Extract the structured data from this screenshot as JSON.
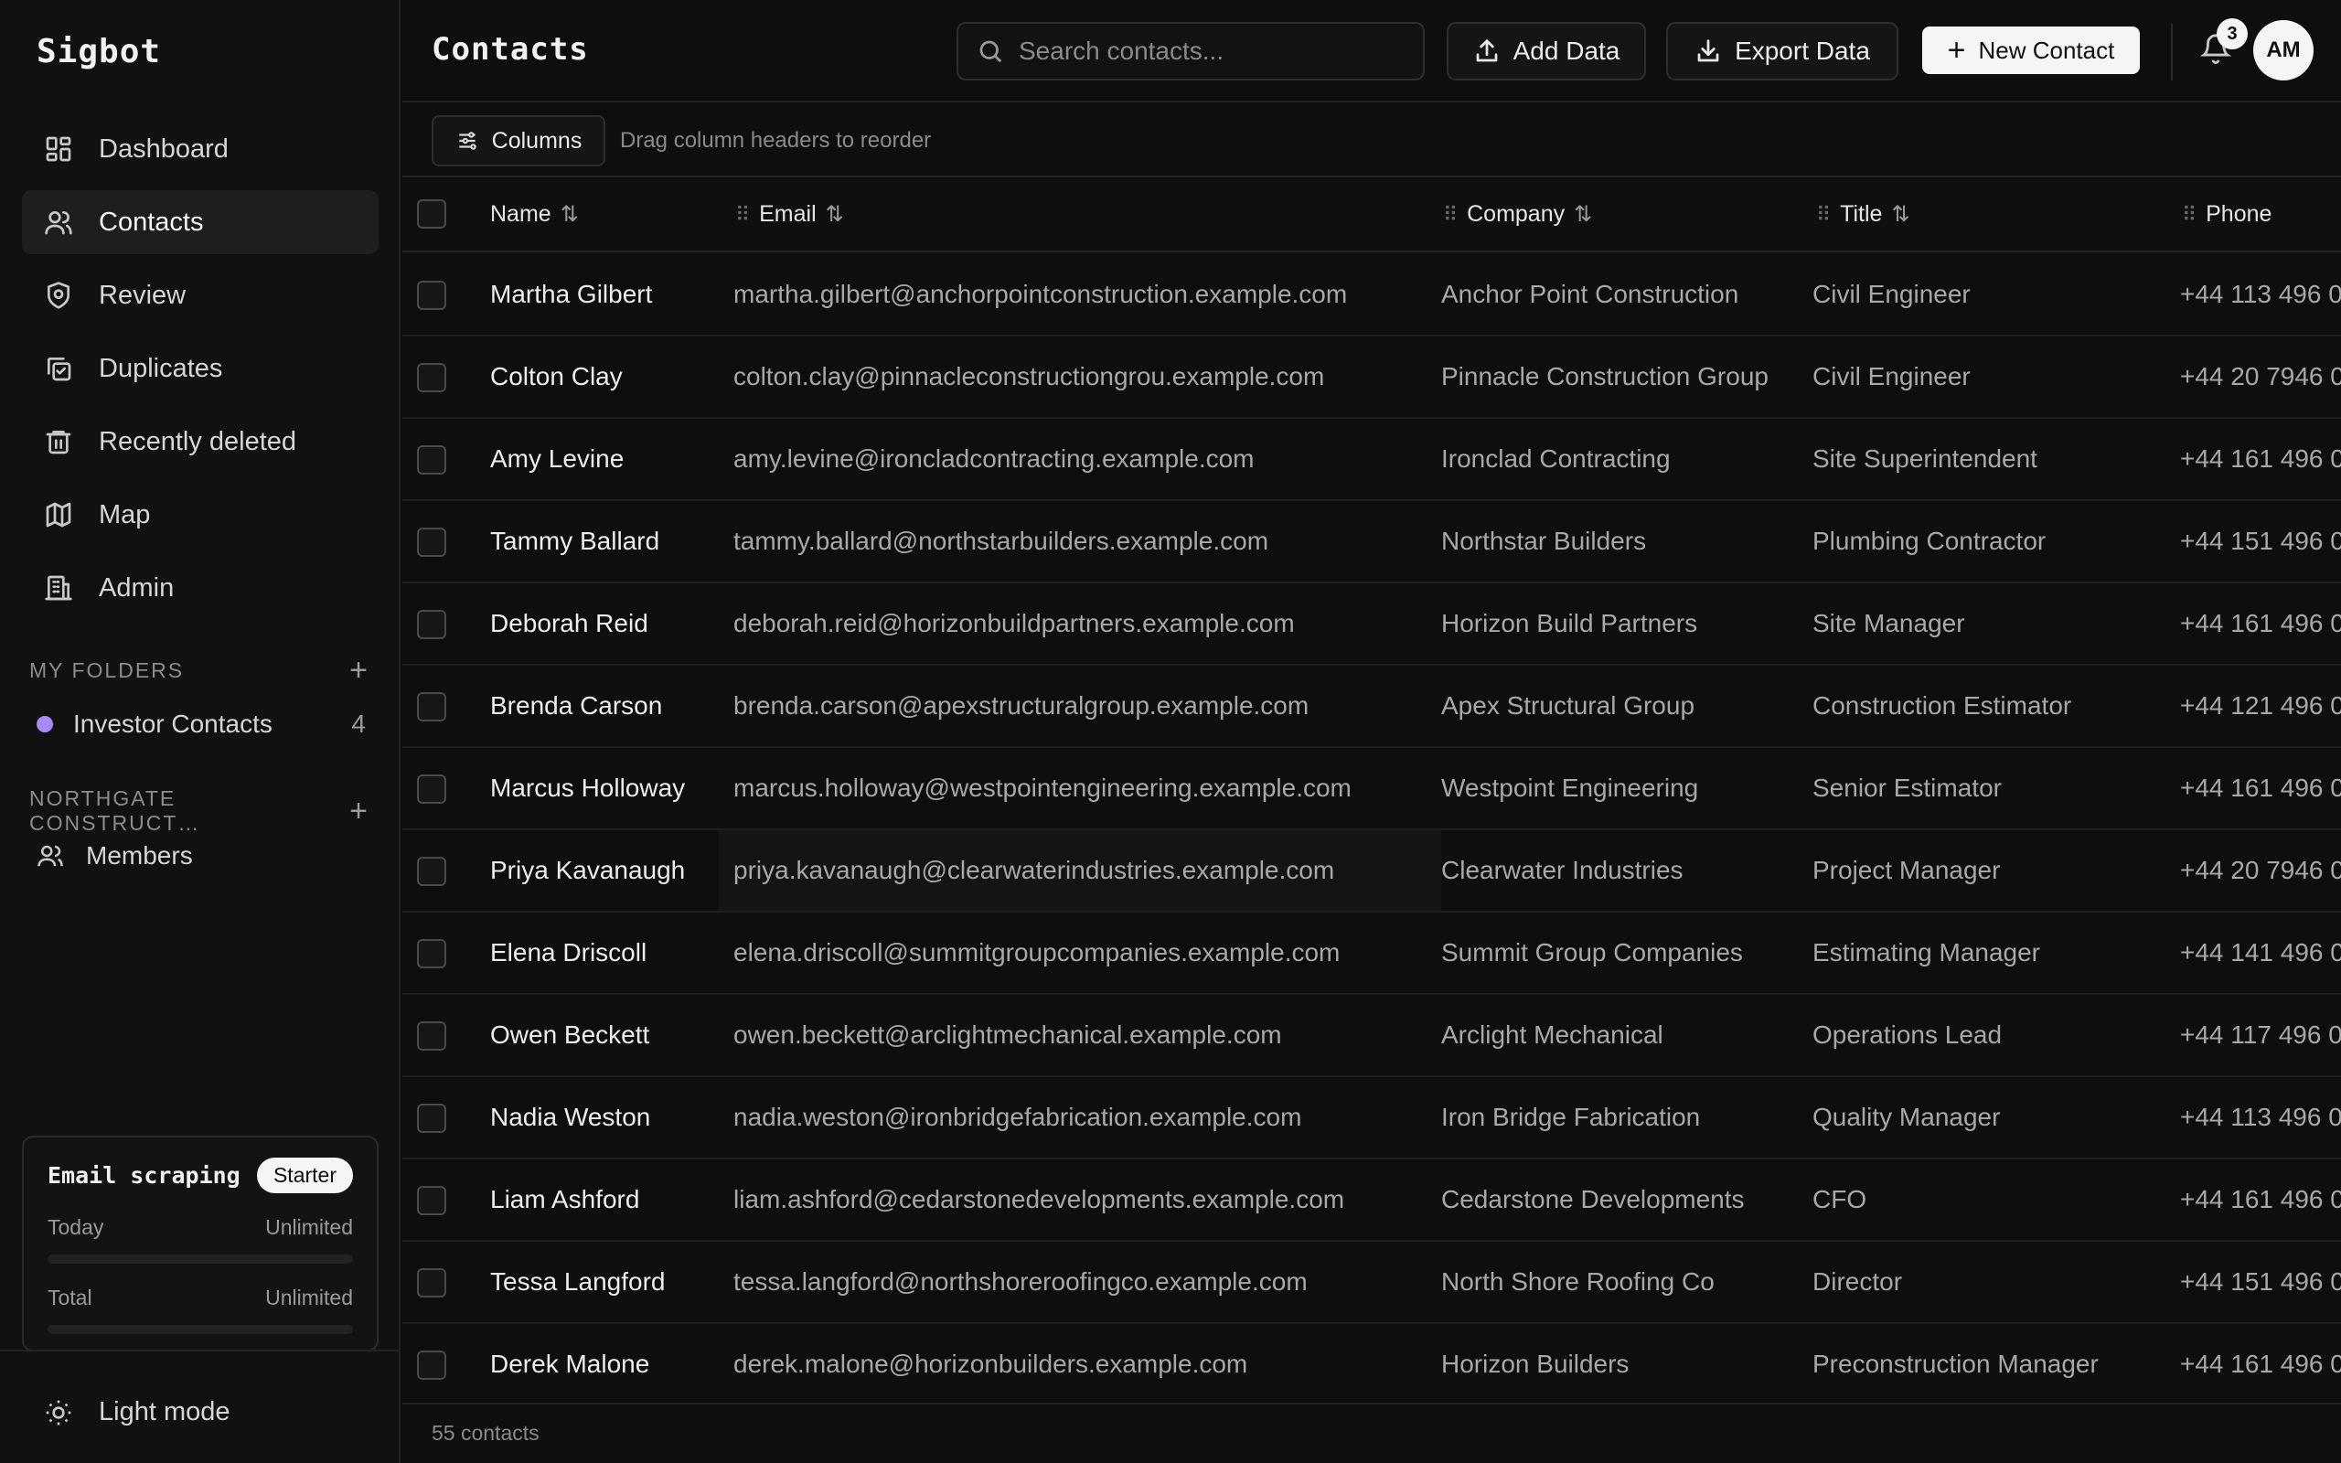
{
  "app": {
    "name": "Sigbot"
  },
  "sidebar": {
    "nav": [
      {
        "label": "Dashboard",
        "icon": "dashboard-icon"
      },
      {
        "label": "Contacts",
        "icon": "users-icon",
        "active": true
      },
      {
        "label": "Review",
        "icon": "shield-icon"
      },
      {
        "label": "Duplicates",
        "icon": "duplicate-icon"
      },
      {
        "label": "Recently deleted",
        "icon": "trash-icon"
      },
      {
        "label": "Map",
        "icon": "map-icon"
      },
      {
        "label": "Admin",
        "icon": "building-icon"
      }
    ],
    "folders_heading": "MY FOLDERS",
    "folders": [
      {
        "label": "Investor Contacts",
        "count": "4",
        "color": "#a78bfa"
      }
    ],
    "org_heading": "NORTHGATE CONSTRUCT…",
    "org_items": [
      {
        "label": "Members",
        "icon": "users-icon"
      }
    ],
    "usage": {
      "title": "Email scraping",
      "plan": "Starter",
      "today_label": "Today",
      "today_value": "Unlimited",
      "total_label": "Total",
      "total_value": "Unlimited"
    },
    "theme_toggle": "Light mode"
  },
  "header": {
    "title": "Contacts",
    "search_placeholder": "Search contacts...",
    "add_data": "Add Data",
    "export_data": "Export Data",
    "new_contact": "New Contact",
    "notification_count": "3",
    "avatar_initials": "AM"
  },
  "toolbar": {
    "columns_label": "Columns",
    "hint": "Drag column headers to reorder"
  },
  "table": {
    "columns": [
      "Name",
      "Email",
      "Company",
      "Title",
      "Phone"
    ],
    "rows": [
      {
        "name": "Martha Gilbert",
        "email": "martha.gilbert@anchorpointconstruction.example.com",
        "company": "Anchor Point Construction",
        "title": "Civil Engineer",
        "phone": "+44 113 496 0"
      },
      {
        "name": "Colton Clay",
        "email": "colton.clay@pinnacleconstructiongrou.example.com",
        "company": "Pinnacle Construction Group",
        "title": "Civil Engineer",
        "phone": "+44 20 7946 0"
      },
      {
        "name": "Amy Levine",
        "email": "amy.levine@ironcladcontracting.example.com",
        "company": "Ironclad Contracting",
        "title": "Site Superintendent",
        "phone": "+44 161 496 0"
      },
      {
        "name": "Tammy Ballard",
        "email": "tammy.ballard@northstarbuilders.example.com",
        "company": "Northstar Builders",
        "title": "Plumbing Contractor",
        "phone": "+44 151 496 0"
      },
      {
        "name": "Deborah Reid",
        "email": "deborah.reid@horizonbuildpartners.example.com",
        "company": "Horizon Build Partners",
        "title": "Site Manager",
        "phone": "+44 161 496 0"
      },
      {
        "name": "Brenda Carson",
        "email": "brenda.carson@apexstructuralgroup.example.com",
        "company": "Apex Structural Group",
        "title": "Construction Estimator",
        "phone": "+44 121 496 0"
      },
      {
        "name": "Marcus Holloway",
        "email": "marcus.holloway@westpointengineering.example.com",
        "company": "Westpoint Engineering",
        "title": "Senior Estimator",
        "phone": "+44 161 496 0"
      },
      {
        "name": "Priya Kavanaugh",
        "email": "priya.kavanaugh@clearwaterindustries.example.com",
        "company": "Clearwater Industries",
        "title": "Project Manager",
        "phone": "+44 20 7946 0"
      },
      {
        "name": "Elena Driscoll",
        "email": "elena.driscoll@summitgroupcompanies.example.com",
        "company": "Summit Group Companies",
        "title": "Estimating Manager",
        "phone": "+44 141 496 0"
      },
      {
        "name": "Owen Beckett",
        "email": "owen.beckett@arclightmechanical.example.com",
        "company": "Arclight Mechanical",
        "title": "Operations Lead",
        "phone": "+44 117 496 0"
      },
      {
        "name": "Nadia Weston",
        "email": "nadia.weston@ironbridgefabrication.example.com",
        "company": "Iron Bridge Fabrication",
        "title": "Quality Manager",
        "phone": "+44 113 496 0"
      },
      {
        "name": "Liam Ashford",
        "email": "liam.ashford@cedarstonedevelopments.example.com",
        "company": "Cedarstone Developments",
        "title": "CFO",
        "phone": "+44 161 496 0"
      },
      {
        "name": "Tessa Langford",
        "email": "tessa.langford@northshoreroofingco.example.com",
        "company": "North Shore Roofing Co",
        "title": "Director",
        "phone": "+44 151 496 0"
      },
      {
        "name": "Derek Malone",
        "email": "derek.malone@horizonbuilders.example.com",
        "company": "Horizon Builders",
        "title": "Preconstruction Manager",
        "phone": "+44 161 496 0"
      }
    ],
    "footer_count": "55 contacts"
  }
}
